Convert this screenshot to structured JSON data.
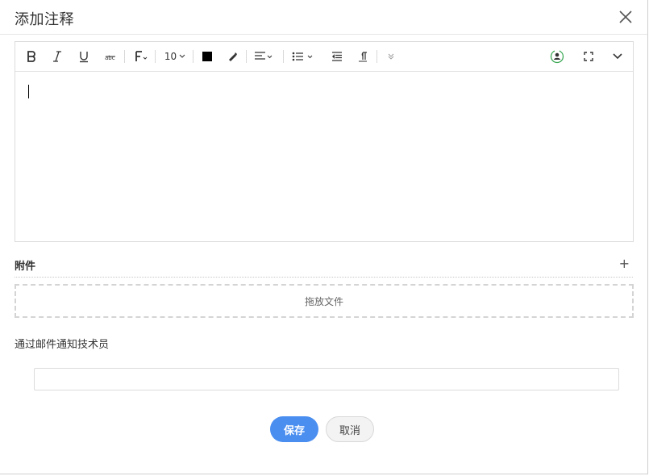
{
  "dialog": {
    "title": "添加注释"
  },
  "toolbar": {
    "font_size": "10",
    "text_color": "#000000"
  },
  "attachments": {
    "label": "附件",
    "add": "+",
    "drop_text": "拖放文件"
  },
  "notify": {
    "label": "通过邮件通知技术员",
    "value": ""
  },
  "buttons": {
    "save": "保存",
    "cancel": "取消"
  },
  "colors": {
    "accent": "#4a8ef0",
    "icon": "#333333",
    "sync_icon": "#3aa854"
  },
  "icons": [
    "close-icon",
    "bold-icon",
    "italic-icon",
    "underline-icon",
    "strikethrough-icon",
    "font-family-icon",
    "text-color-icon",
    "highlight-icon",
    "align-icon",
    "list-icon",
    "outdent-icon",
    "paragraph-icon",
    "more-icon",
    "sync-user-icon",
    "fullscreen-icon",
    "collapse-icon"
  ]
}
